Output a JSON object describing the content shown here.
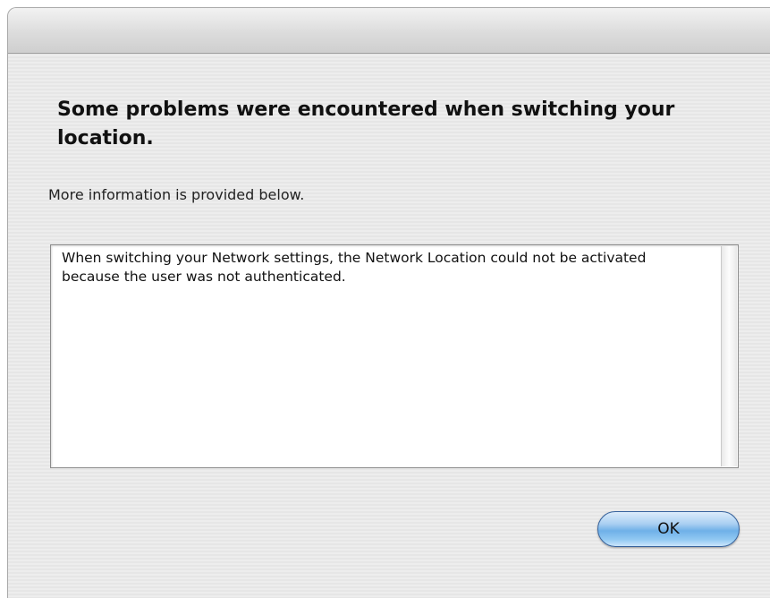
{
  "dialog": {
    "heading": "Some problems were encountered when switching your location.",
    "subtext": "More information is provided below.",
    "details_text": "When switching your Network settings, the Network Location could not be activated because the user was not authenticated.",
    "ok_label": "OK"
  },
  "colors": {
    "button_accent": "#6fb0e8",
    "window_background": "#ececec"
  }
}
